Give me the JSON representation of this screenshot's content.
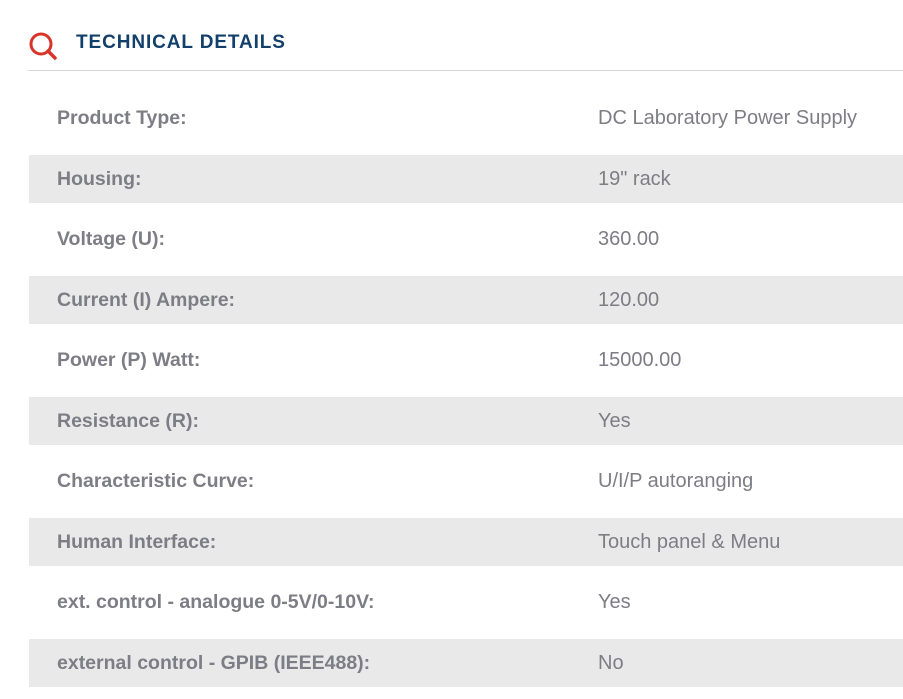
{
  "header": {
    "title": "TECHNICAL DETAILS",
    "icon": "search-icon",
    "accent_color": "#d9342b",
    "title_color": "#13406b"
  },
  "details": [
    {
      "label": "Product Type:",
      "value": "DC Laboratory Power Supply"
    },
    {
      "label": "Housing:",
      "value": "19\" rack"
    },
    {
      "label": "Voltage (U):",
      "value": "360.00"
    },
    {
      "label": "Current (I) Ampere:",
      "value": "120.00"
    },
    {
      "label": "Power (P) Watt:",
      "value": "15000.00"
    },
    {
      "label": "Resistance (R):",
      "value": "Yes"
    },
    {
      "label": "Characteristic Curve:",
      "value": "U/I/P autoranging"
    },
    {
      "label": "Human Interface:",
      "value": "Touch panel & Menu"
    },
    {
      "label": "ext. control - analogue 0-5V/0-10V:",
      "value": "Yes"
    },
    {
      "label": "external control - GPIB (IEEE488):",
      "value": "No"
    }
  ]
}
